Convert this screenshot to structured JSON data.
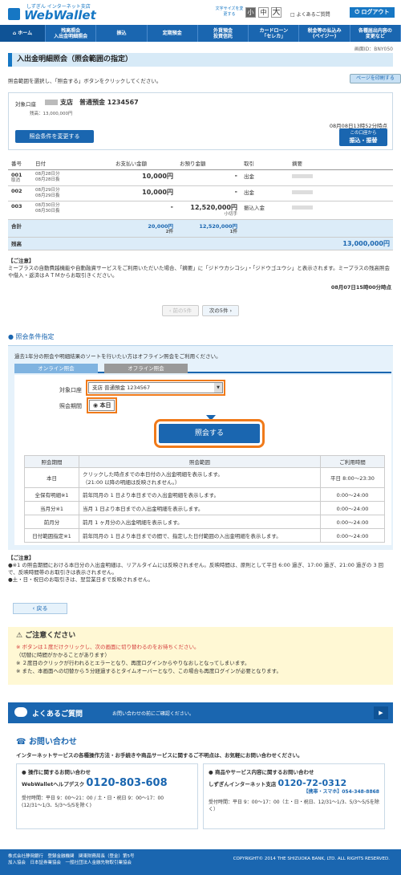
{
  "header": {
    "logo_sub": "しずぎん インターネット支店",
    "logo_main": "WebWallet",
    "font_size_label": "文字サイズを変更する",
    "font_small": "小",
    "font_mid": "中",
    "font_big": "大",
    "faq": "よくあるご質問",
    "logout": "ログアウト"
  },
  "nav": [
    "ホーム",
    "残高照会\n入出金明細照会",
    "振込",
    "定期預金",
    "外貨預金\n投資信託",
    "カードローン\n「セレカ」",
    "税金等の払込み\n(ペイジー)",
    "各種届出内容の\n変更など"
  ],
  "screen_id": "画面ID：BNY050",
  "page_title": "入出金明細照会（照会範囲の指定）",
  "instruction": "照会範囲を選択し、「照会する」ボタンをクリックしてください。",
  "print_button": "ページを印刷する",
  "account": {
    "label": "対象口座",
    "branch_type_number": "支店　普通預金 1234567",
    "balance": "残高：13,000,000円",
    "as_of": "08月08日13時52分時点",
    "change_cond_button": "照会条件を変更する",
    "transfer_button_line1": "この口座から",
    "transfer_button_line2": "振込・振替"
  },
  "table": {
    "headers": [
      "番号",
      "日付",
      "お支払い金額",
      "お預り金額",
      "取引",
      "摘要"
    ],
    "rows": [
      {
        "no": "001",
        "sub": "取消",
        "date1": "08月28日分",
        "date2": "08月28日扱",
        "pay": "10,000円",
        "deposit": "-",
        "deposit_note": "",
        "type": "出金"
      },
      {
        "no": "002",
        "sub": "",
        "date1": "08月29日分",
        "date2": "08月29日扱",
        "pay": "10,000円",
        "deposit": "-",
        "deposit_note": "",
        "type": "出金"
      },
      {
        "no": "003",
        "sub": "",
        "date1": "08月30日分",
        "date2": "08月30日扱",
        "pay": "-",
        "deposit": "12,520,000円",
        "deposit_note": "小切手",
        "type": "振込入金"
      }
    ],
    "total_label": "合計",
    "total_pay": "20,000円",
    "total_pay_count": "2件",
    "total_deposit": "12,520,000円",
    "total_deposit_count": "1件",
    "balance_label": "残高",
    "balance_value": "13,000,000円"
  },
  "notice": {
    "title": "【ご注意】",
    "text": "ミープラスの自動費越機能や自動融資サービスをご利用いただいた場合、「摘要」に「ジドウカシコシ」・「ジドウゴユウシ」と表示されます。ミープラスの残高照会や借入・返済はＡＴＭからお取引きください。",
    "time": "08月07日15時00分時点"
  },
  "pager": {
    "prev": "前の5件",
    "next": "次の5件"
  },
  "inquiry": {
    "section_title": "照会条件指定",
    "desc": "過去1年分の照会や明細結果のソートを行いたい方はオフライン照会をご利用ください。",
    "tab_online": "オンライン照会",
    "tab_offline": "オフライン照会",
    "account_label": "対象口座",
    "account_value": "支店 普通預金 1234567",
    "period_label": "照会期間",
    "period_value": "本日",
    "submit": "照会する",
    "cond_headers": [
      "照会期間",
      "照会範囲",
      "ご利用時間"
    ],
    "cond_rows": [
      {
        "p": "本日",
        "r": "クリックした時点までの本日付の入出金明細を表示します。\n（21:00 以降の明細は反映されません。）",
        "t": "平日 8:00～23:30"
      },
      {
        "p": "全保有明細※1",
        "r": "前年同月の 1 日より本日までの入出金明細を表示します。",
        "t": "0:00～24:00"
      },
      {
        "p": "当月分※1",
        "r": "当月 1 日より本日までの入出金明細を表示します。",
        "t": "0:00～24:00"
      },
      {
        "p": "前月分",
        "r": "前月 1 ヶ月分の入出金明細を表示します。",
        "t": "0:00～24:00"
      },
      {
        "p": "日付範囲指定※1",
        "r": "前年同月の 1 日より本日までの間で、指定した日付範囲の入出金明細を表示します。",
        "t": "0:00～24:00"
      }
    ],
    "attn_title": "【ご注意】",
    "attn1": "●※1 の照会期間における本日分の入出金明細は、リアルタイムには反映されません。反映時間は、原則として平日 6:00 過ぎ、17:00 過ぎ、21:00 過ぎの 3 回で、反映時間帯のお取引きは表示されません。",
    "attn2": "●土・日・祝日のお取引きは、翌営業日まで反映されません。"
  },
  "back": "戻る",
  "warn": {
    "title": "ご注意ください",
    "l1": "※ ボタンは１度だけクリックし、次の画面に切り替わるのをお待ちください。",
    "l2": "（切替に時間がかかることがあります）",
    "l3": "※ ２度目のクリックが行われるとエラーとなり、再度ログインからやりなおしとなってしまいます。",
    "l4": "※ また、本画面への切替から５分経過するとタイムオーバーとなり、この場合も再度ログインが必要となります。"
  },
  "faqbar": {
    "title": "よくあるご質問",
    "sub": "お問い合わせの前にご確認ください。",
    "go": "▶"
  },
  "contact": {
    "title": "お問い合わせ",
    "sub": "インターネットサービスの各種操作方法・お手続きや商品サービスに関するご不明点は、お気軽にお問い合わせください。",
    "c1_head": "操作に関するお問い合わせ",
    "c1_name": "WebWalletヘルプデスク",
    "c1_tel": "0120-803-608",
    "c1_hours": "受付時間：平日 9：00～21：00 / 土・日・祝日 9：00～17：00",
    "c1_hours2": "(12/31～1/3、5/3～5/5を除く)",
    "c2_head": "商品やサービス内容に関するお問い合わせ",
    "c2_name": "しずぎんインターネット支店",
    "c2_tel": "0120-72-0312",
    "c2_mobile": "【携帯・スマホ】054-348-8868",
    "c2_hours": "受付時間：平日 9：00～17：00（土・日・祝日、12/31～1/3、5/3～5/5を除く）"
  },
  "footer": {
    "line1": "株式会社静岡銀行　登録金融機関　関東財務局長（登金）第5号",
    "line2": "加入協会　日本証券業協会　一般社団法人金融先物取引業協会",
    "copy": "COPYRIGHT© 2014 THE SHIZUOKA BANK, LTD. ALL RIGHTS RESERVED."
  }
}
